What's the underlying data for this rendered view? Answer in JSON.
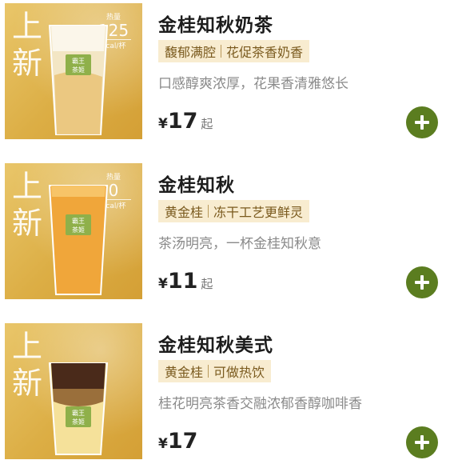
{
  "products": [
    {
      "badge": "上新",
      "kcal_label": "热量",
      "kcal_value": "125",
      "kcal_unit": "Kcal/杯",
      "cup_logo_top": "霸王",
      "cup_logo_bottom": "茶姬",
      "name": "金桂知秋奶茶",
      "tag1": "馥郁满腔",
      "tag2": "花促茶香奶香",
      "description": "口感醇爽浓厚，花果香清雅悠长",
      "currency": "¥",
      "price": "17",
      "price_suffix": "起",
      "add_label": "+"
    },
    {
      "badge": "上新",
      "kcal_label": "热量",
      "kcal_value": "0",
      "kcal_unit": "Kcal/杯",
      "cup_logo_top": "霸王",
      "cup_logo_bottom": "茶姬",
      "name": "金桂知秋",
      "tag1": "黄金桂",
      "tag2": "冻干工艺更鲜灵",
      "description": "茶汤明亮，一杯金桂知秋意",
      "currency": "¥",
      "price": "11",
      "price_suffix": "起",
      "add_label": "+"
    },
    {
      "badge": "上新",
      "kcal_label": "",
      "kcal_value": "",
      "kcal_unit": "",
      "cup_logo_top": "霸王",
      "cup_logo_bottom": "茶姬",
      "name": "金桂知秋美式",
      "tag1": "黄金桂",
      "tag2": "可做热饮",
      "description": "桂花明亮茶香交融浓郁香醇咖啡香",
      "currency": "¥",
      "price": "17",
      "price_suffix": "",
      "add_label": "+"
    }
  ],
  "colors": {
    "accent_green": "#5b7d20",
    "tag_bg": "#f8ecd0",
    "tag_text": "#7a5a1e",
    "thumb_gold": "#dcae45"
  },
  "icons": {
    "add": "plus-icon"
  }
}
